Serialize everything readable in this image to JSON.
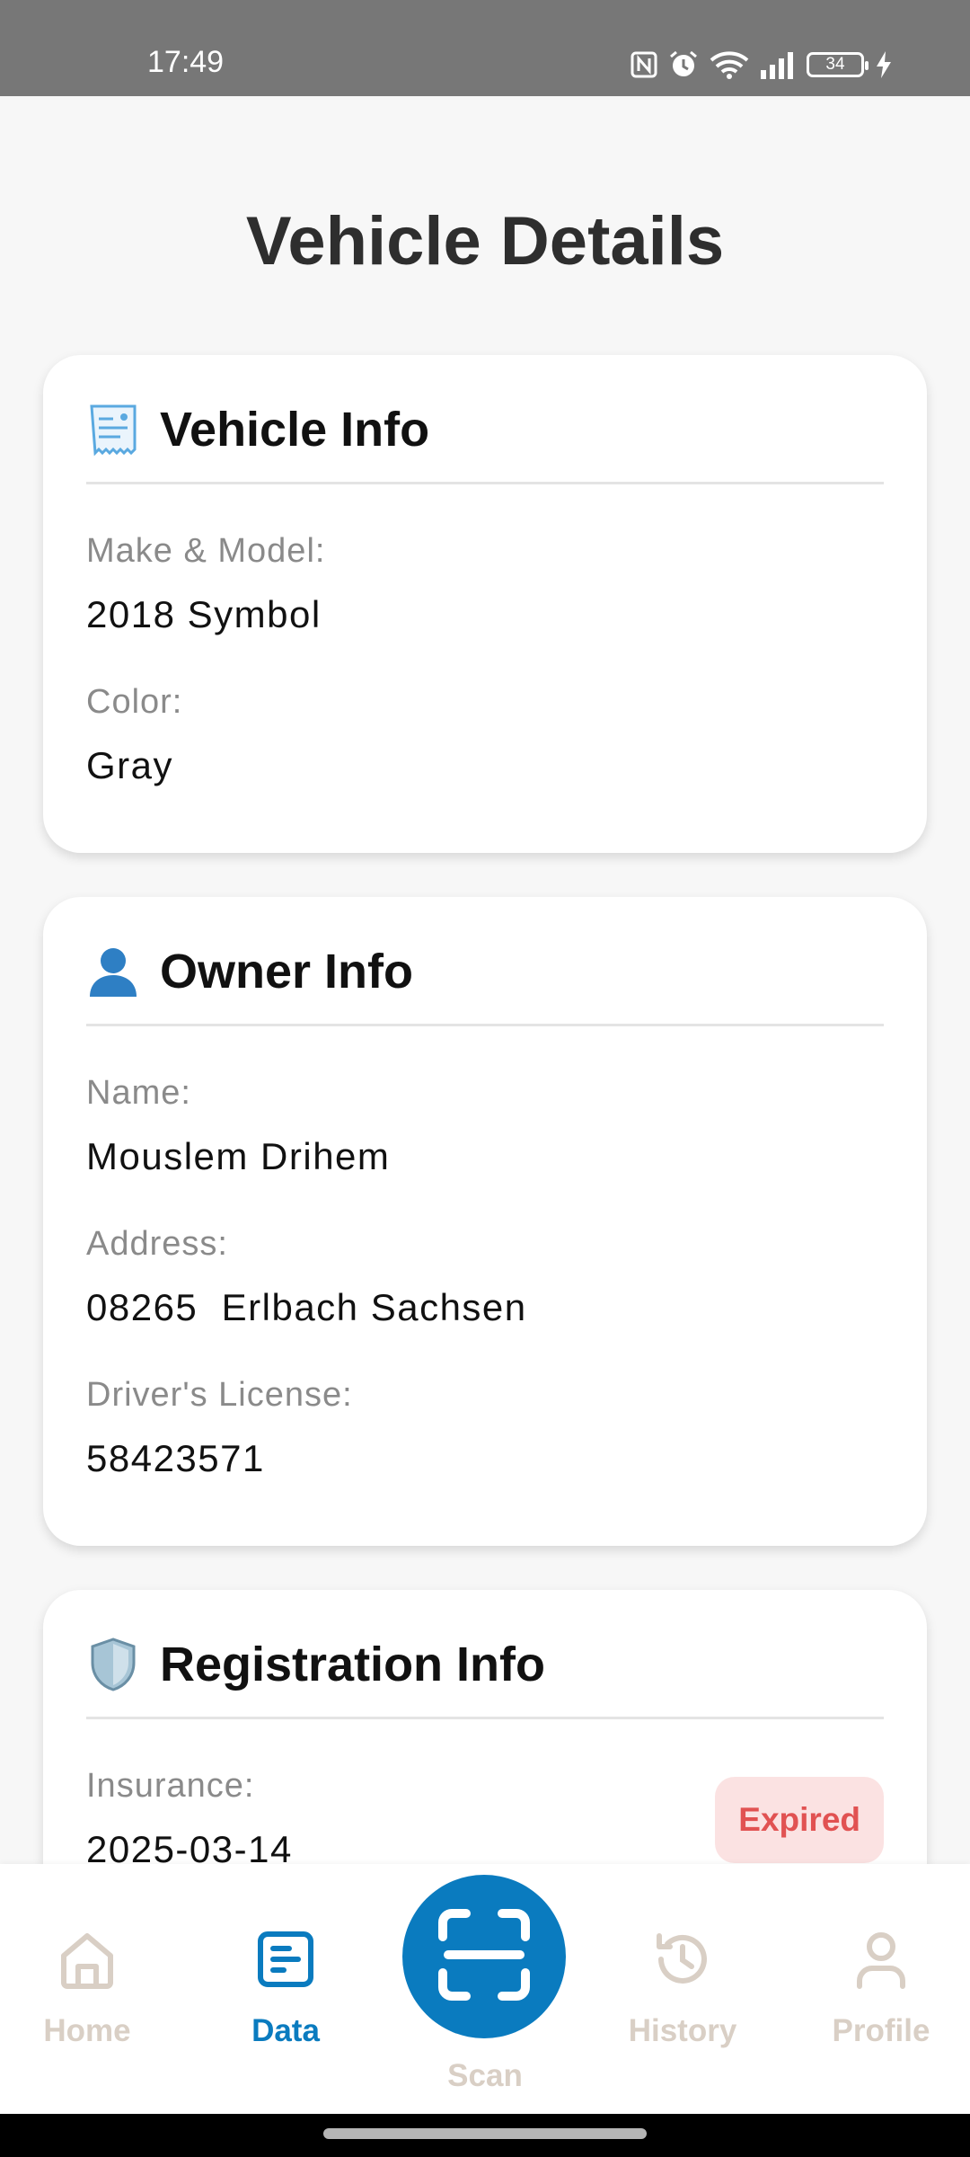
{
  "status_bar": {
    "time": "17:49",
    "battery": "34"
  },
  "page": {
    "title": "Vehicle Details"
  },
  "vehicle_info": {
    "title": "Vehicle Info",
    "icon": "receipt-icon",
    "fields": [
      {
        "label": "Make & Model:",
        "value": "2018 Symbol"
      },
      {
        "label": "Color:",
        "value": "Gray"
      }
    ]
  },
  "owner_info": {
    "title": "Owner Info",
    "icon": "person-icon",
    "fields": [
      {
        "label": "Name:",
        "value": "Mouslem Drihem"
      },
      {
        "label": "Address:",
        "value": "08265  Erlbach Sachsen"
      },
      {
        "label": "Driver's License:",
        "value": "58423571"
      }
    ]
  },
  "registration_info": {
    "title": "Registration Info",
    "icon": "shield-icon",
    "fields": [
      {
        "label": "Insurance:",
        "value": "2025-03-14",
        "status": "Expired"
      }
    ]
  },
  "bottom_nav": {
    "items": [
      {
        "label": "Home",
        "icon": "home-icon"
      },
      {
        "label": "Data",
        "icon": "document-icon",
        "active": true
      },
      {
        "label": "Scan",
        "icon": "scan-icon"
      },
      {
        "label": "History",
        "icon": "history-icon"
      },
      {
        "label": "Profile",
        "icon": "profile-icon"
      }
    ]
  },
  "colors": {
    "accent": "#0a7bbf",
    "inactive": "#d9cfc5",
    "expired_text": "#e15252",
    "expired_bg": "#fbe2e2",
    "status_bar": "#777777"
  }
}
